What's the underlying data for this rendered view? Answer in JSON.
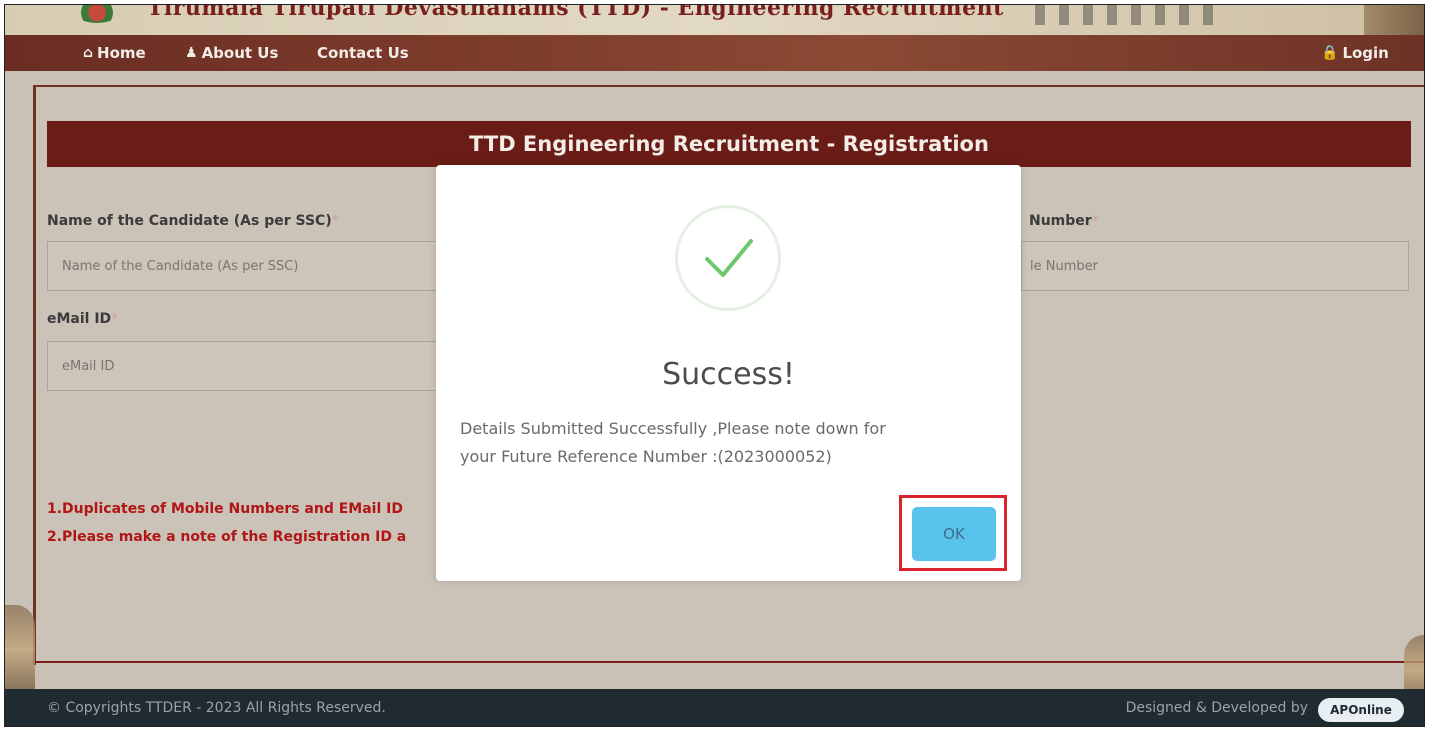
{
  "banner": {
    "title": "Tirumala Tirupati Devasthanams (TTD) - Engineering Recruitment"
  },
  "nav": {
    "home_label": "Home",
    "about_label": "About Us",
    "contact_label": "Contact Us",
    "login_label": "Login"
  },
  "form": {
    "header": "TTD Engineering Recruitment - Registration",
    "name_label": "Name of the Candidate (As per SSC)",
    "name_placeholder": "Name of the Candidate (As per SSC)",
    "mobile_label_visible": "Number",
    "mobile_placeholder_visible": "le Number",
    "email_label": "eMail ID",
    "email_placeholder": "eMail ID",
    "required_mark": "*"
  },
  "notes": [
    "1.Duplicates of Mobile Numbers and EMail ID",
    "2.Please make a note of the Registration ID a"
  ],
  "modal": {
    "title": "Success!",
    "message_line1": "Details Submitted Successfully ,Please note down for",
    "message_line2": "your Future Reference Number :(2023000052)",
    "ok_label": "OK"
  },
  "footer": {
    "copyright": "© Copyrights TTDER - 2023 All Rights Reserved.",
    "designed_by": "Designed & Developed by",
    "brand": "APOnline"
  },
  "colors": {
    "header_maroon": "#6a1d16",
    "note_red": "#b11616",
    "ok_blue": "#58c4ec",
    "highlight_red": "#d9232d",
    "check_green": "#6cc86a"
  }
}
